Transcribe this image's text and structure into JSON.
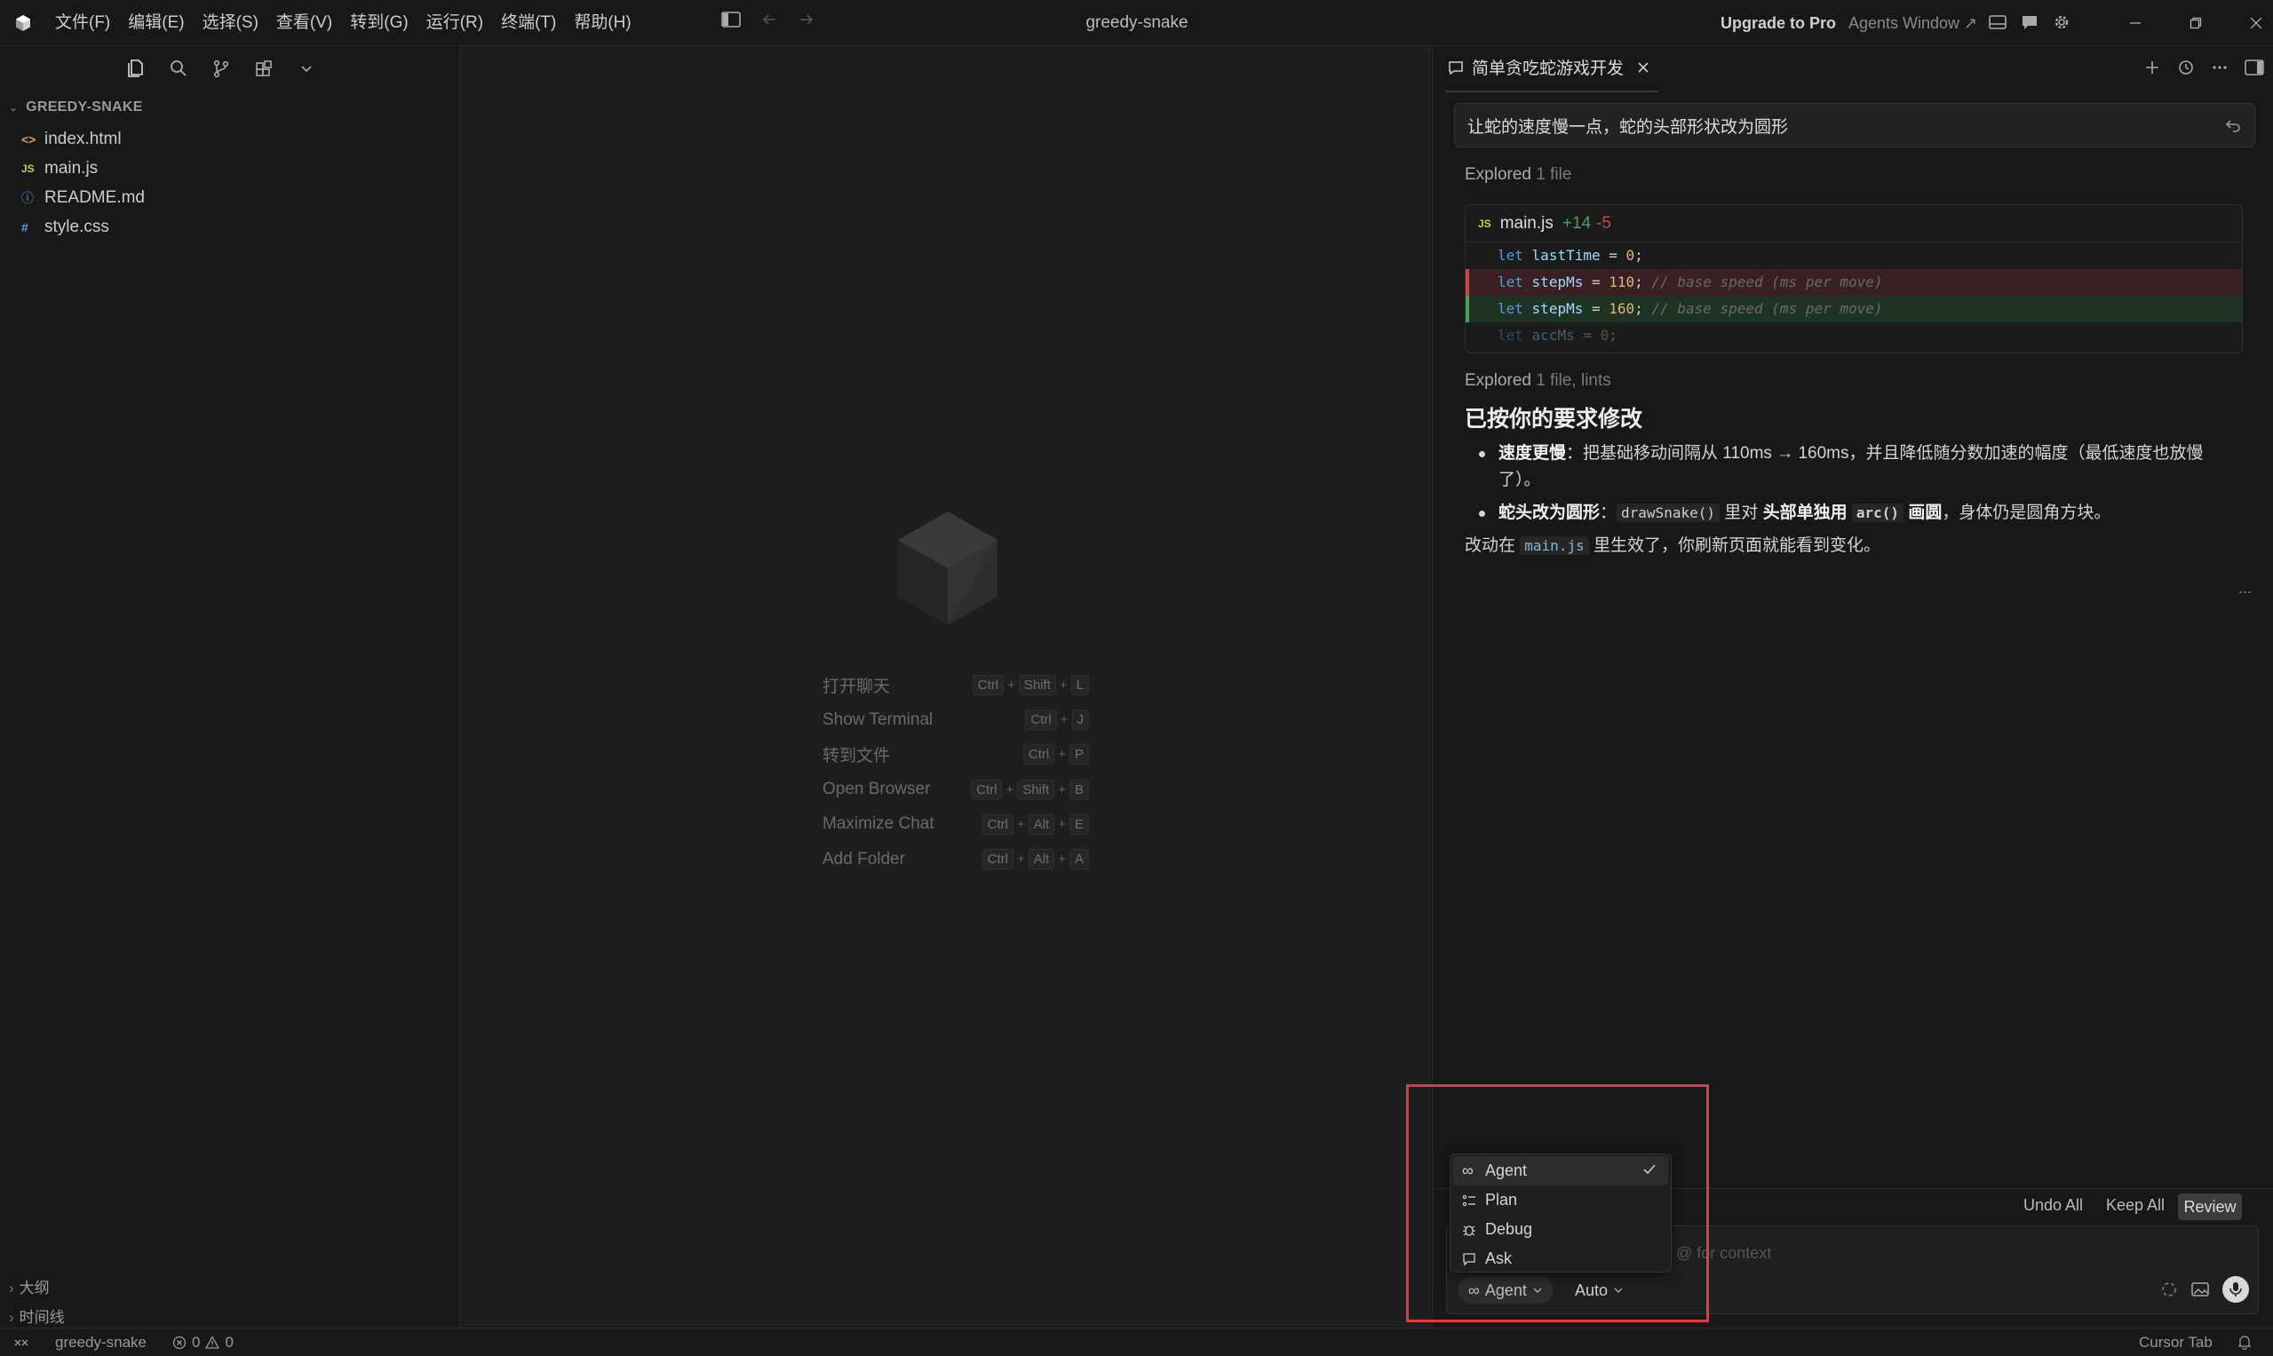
{
  "menu": [
    "文件(F)",
    "编辑(E)",
    "选择(S)",
    "查看(V)",
    "转到(G)",
    "运行(R)",
    "终端(T)",
    "帮助(H)"
  ],
  "window_title": "greedy-snake",
  "upgrade_label": "Upgrade to Pro",
  "agents_window_label": "Agents Window ↗",
  "explorer": {
    "title": "GREEDY-SNAKE",
    "files": [
      {
        "icon": "<>",
        "name": "index.html",
        "color": "#e4a049"
      },
      {
        "icon": "JS",
        "name": "main.js",
        "color": "#d8c84a"
      },
      {
        "icon": "ⓘ",
        "name": "README.md",
        "color": "#4fa3d6"
      },
      {
        "icon": "#",
        "name": "style.css",
        "color": "#5aa0d8"
      }
    ],
    "outline_label": "大纲",
    "timeline_label": "时间线"
  },
  "editor": {
    "shortcuts": [
      {
        "label": "打开聊天",
        "keys": [
          "Ctrl",
          "Shift",
          "L"
        ]
      },
      {
        "label": "Show Terminal",
        "keys": [
          "Ctrl",
          "J"
        ]
      },
      {
        "label": "转到文件",
        "keys": [
          "Ctrl",
          "P"
        ]
      },
      {
        "label": "Open Browser",
        "keys": [
          "Ctrl",
          "Shift",
          "B"
        ]
      },
      {
        "label": "Maximize Chat",
        "keys": [
          "Ctrl",
          "Alt",
          "E"
        ]
      },
      {
        "label": "Add Folder",
        "keys": [
          "Ctrl",
          "Alt",
          "A"
        ]
      }
    ]
  },
  "chat": {
    "tab_title": "简单贪吃蛇游戏开发",
    "user_message": "让蛇的速度慢一点，蛇的头部形状改为圆形",
    "explored_1": {
      "label": "Explored",
      "detail": "1 file"
    },
    "diff": {
      "file_badge": "JS",
      "file": "main.js",
      "added": "+14",
      "removed": "-5",
      "lines": [
        {
          "kind": "ctx",
          "kw": "let",
          "name": "lastTime",
          "value": "0",
          "comment": ""
        },
        {
          "kind": "del",
          "kw": "let",
          "name": "stepMs",
          "value": "110",
          "comment": "// base speed (ms per move)"
        },
        {
          "kind": "add",
          "kw": "let",
          "name": "stepMs",
          "value": "160",
          "comment": "// base speed (ms per move)"
        },
        {
          "kind": "fade",
          "kw": "let",
          "name": "accMs",
          "value": "0",
          "comment": ""
        }
      ]
    },
    "explored_2": {
      "label": "Explored",
      "detail": "1 file, lints"
    },
    "summary_title": "已按你的要求修改",
    "bullet_1": {
      "bold": "速度更慢",
      "text": "：把基础移动间隔从 110ms → 160ms，并且降低随分数加速的幅度（最低速度也放慢了）。"
    },
    "bullet_2": {
      "bold": "蛇头改为圆形",
      "sep": "：",
      "code1": "drawSnake()",
      "mid": " 里对 ",
      "bold2": "头部单独用",
      "code2": "arc()",
      "bold3": "画圆",
      "tail": "，身体仍是圆角方块。"
    },
    "footer_pre": "改动在 ",
    "footer_code": "main.js",
    "footer_post": " 里生效了，你刷新页面就能看到变化。",
    "more": "..."
  },
  "composer": {
    "undo_all": "Undo All",
    "keep_all": "Keep All",
    "review": "Review",
    "placeholder": "@ for context",
    "mode": "Agent",
    "model": "Auto"
  },
  "mode_menu": {
    "items": [
      {
        "label": "Agent",
        "icon": "infinity-icon",
        "selected": true
      },
      {
        "label": "Plan",
        "icon": "checklist-icon",
        "selected": false
      },
      {
        "label": "Debug",
        "icon": "bug-icon",
        "selected": false
      },
      {
        "label": "Ask",
        "icon": "chat-bubble-icon",
        "selected": false
      }
    ]
  },
  "statusbar": {
    "project": "greedy-snake",
    "errors": "0",
    "warnings": "0",
    "cursor_tab": "Cursor Tab"
  },
  "colors": {
    "highlight": "#e23b3b",
    "diff_added": "#4aa05a",
    "diff_removed": "#c04a4a"
  }
}
